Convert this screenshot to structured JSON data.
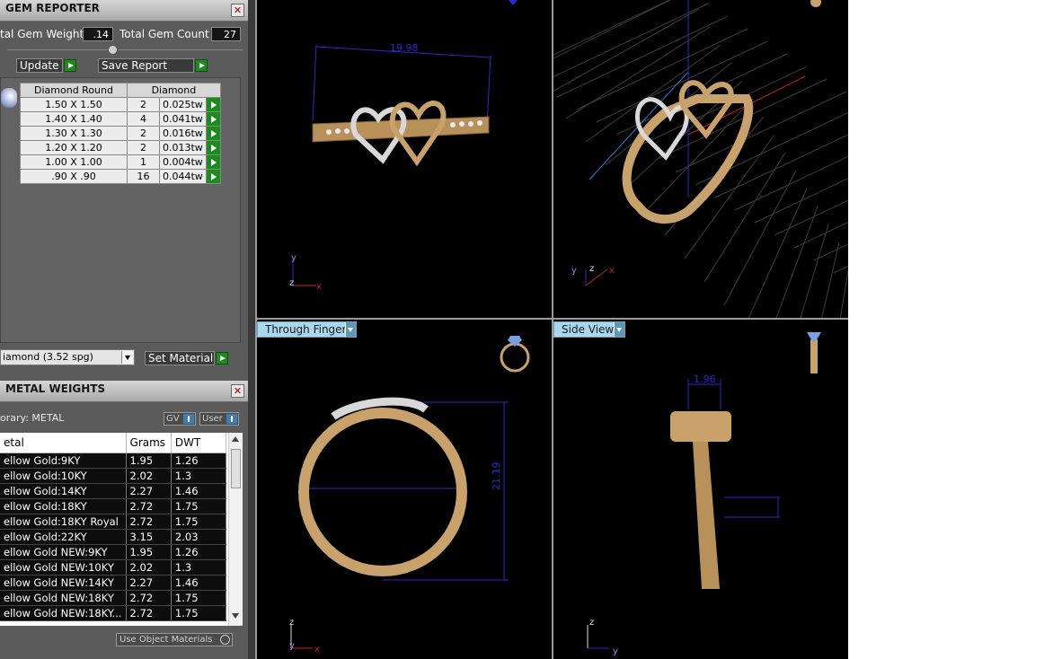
{
  "gem_reporter": {
    "title": "GEM REPORTER",
    "total_gem_weight_label": "tal Gem Weight",
    "total_gem_weight_value": ".14",
    "total_gem_count_label": "Total Gem Count",
    "total_gem_count_value": "27",
    "update_label": "Update",
    "save_report_label": "Save Report",
    "table_headers": [
      "Diamond Round",
      "Diamond"
    ],
    "rows": [
      {
        "size": "1.50 X 1.50",
        "count": "2",
        "weight": "0.025tw"
      },
      {
        "size": "1.40 X 1.40",
        "count": "4",
        "weight": "0.041tw"
      },
      {
        "size": "1.30 X 1.30",
        "count": "2",
        "weight": "0.016tw"
      },
      {
        "size": "1.20 X 1.20",
        "count": "2",
        "weight": "0.013tw"
      },
      {
        "size": "1.00 X 1.00",
        "count": "1",
        "weight": "0.004tw"
      },
      {
        "size": ".90 X .90",
        "count": "16",
        "weight": "0.044tw"
      }
    ],
    "material_select_value": "iamond    (3.52 spg)",
    "set_material_label": "Set Material"
  },
  "metal_weights": {
    "title": "METAL WEIGHTS",
    "library_label": "orary: METAL",
    "gv_label": "GV",
    "user_label": "User",
    "headers": [
      "etal",
      "Grams",
      "DWT"
    ],
    "rows": [
      {
        "metal": "ellow Gold:9KY",
        "grams": "1.95",
        "dwt": "1.26"
      },
      {
        "metal": "ellow Gold:10KY",
        "grams": "2.02",
        "dwt": "1.3"
      },
      {
        "metal": "ellow Gold:14KY",
        "grams": "2.27",
        "dwt": "1.46"
      },
      {
        "metal": "ellow Gold:18KY",
        "grams": "2.72",
        "dwt": "1.75"
      },
      {
        "metal": "ellow Gold:18KY Royal",
        "grams": "2.72",
        "dwt": "1.75"
      },
      {
        "metal": "ellow Gold:22KY",
        "grams": "3.15",
        "dwt": "2.03"
      },
      {
        "metal": "ellow Gold NEW:9KY",
        "grams": "1.95",
        "dwt": "1.26"
      },
      {
        "metal": "ellow Gold NEW:10KY",
        "grams": "2.02",
        "dwt": "1.3"
      },
      {
        "metal": "ellow Gold NEW:14KY",
        "grams": "2.27",
        "dwt": "1.46"
      },
      {
        "metal": "ellow Gold NEW:18KY",
        "grams": "2.72",
        "dwt": "1.75"
      },
      {
        "metal": "ellow Gold NEW:18KY...",
        "grams": "2.72",
        "dwt": "1.75"
      }
    ],
    "use_object_materials_label": "Use Object Materials"
  },
  "viewports": {
    "top_view": {
      "dimension": "19.98",
      "axis_y": "y",
      "axis_z": "z",
      "axis_x": "x"
    },
    "perspective": {
      "axis_y": "y",
      "axis_z": "z",
      "axis_x": "x"
    },
    "through_finger": {
      "tab": "Through Finger",
      "dimension": "21.19",
      "axis_z": "z",
      "axis_y": "y",
      "axis_x": "x"
    },
    "side_view": {
      "tab": "Side View",
      "dimension": "1.96",
      "axis_z": "z",
      "axis_y": "y"
    }
  },
  "colors": {
    "panel_bg": "#5b5b5b",
    "viewport_bg": "#000000",
    "gold": "#c9a16a",
    "dimension_blue": "#2a2ad0",
    "green_button": "#1f8a1f",
    "tab_blue": "#a9d7ee"
  }
}
